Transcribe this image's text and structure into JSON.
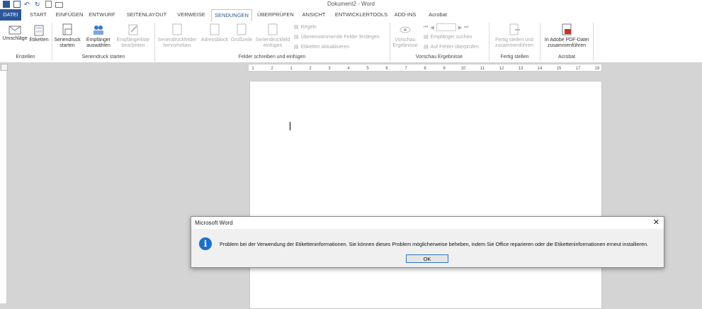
{
  "window": {
    "title": "Dokument2 - Word"
  },
  "tabs": [
    "DATEI",
    "START",
    "EINFÜGEN",
    "ENTWURF",
    "SEITENLAYOUT",
    "VERWEISE",
    "SENDUNGEN",
    "ÜBERPRÜFEN",
    "ANSICHT",
    "ENTWICKLERTOOLS",
    "ADD-INS",
    "Acrobat"
  ],
  "active_tab": "SENDUNGEN",
  "ribbon": {
    "erstellen": {
      "label": "Erstellen",
      "umschlaege": "Umschläge",
      "etiketten": "Etiketten"
    },
    "seriendruck_starten": {
      "label": "Seriendruck starten",
      "seriendruck_1": "Seriendruck",
      "seriendruck_2": "starten",
      "empfaenger_1": "Empfänger",
      "empfaenger_2": "auswählen",
      "empfaengerliste_1": "Empfängerliste",
      "empfaengerliste_2": "bearbeiten"
    },
    "felder": {
      "label": "Felder schreiben und einfügen",
      "hervorheben_1": "Seriendruckfelder",
      "hervorheben_2": "hervorheben",
      "adressblock": "Adressblock",
      "grusszeile": "Grußzeile",
      "einfuegen_1": "Seriendruckfeld",
      "einfuegen_2": "einfügen",
      "regeln": "Regeln",
      "felder_festlegen": "Übereinstimmende Felder festlegen",
      "etiketten_aktualisieren": "Etiketten aktualisieren"
    },
    "vorschau": {
      "label": "Vorschau Ergebnisse",
      "vorschau_1": "Vorschau",
      "vorschau_2": "Ergebnisse",
      "empfaenger_suchen": "Empfänger suchen",
      "fehler_pruefen": "Auf Fehler überprüfen"
    },
    "fertig": {
      "label": "Fertig stellen",
      "fertig_1": "Fertig stellen und",
      "fertig_2": "zusammenführen"
    },
    "acrobat": {
      "label": "Acrobat",
      "pdf_1": "In Adobe PDF-Datei",
      "pdf_2": "zusammenführen"
    }
  },
  "ruler_numbers": [
    "1",
    "2",
    "1",
    "2",
    "3",
    "4",
    "5",
    "6",
    "7",
    "8",
    "9",
    "10",
    "11",
    "12",
    "13",
    "14",
    "15",
    "17",
    "18"
  ],
  "dialog": {
    "title": "Microsoft Word",
    "message": "Problem bei der Verwendung der Etiketteninformationen. Sie können dieses Problem möglicherweise beheben, indem Sie Office reparieren oder die Etiketteninformationen erneut installieren.",
    "ok_label": "OK",
    "close_glyph": "✕",
    "info_glyph": "i"
  },
  "colors": {
    "accent": "#2b579a",
    "info": "#1e6fc7"
  }
}
